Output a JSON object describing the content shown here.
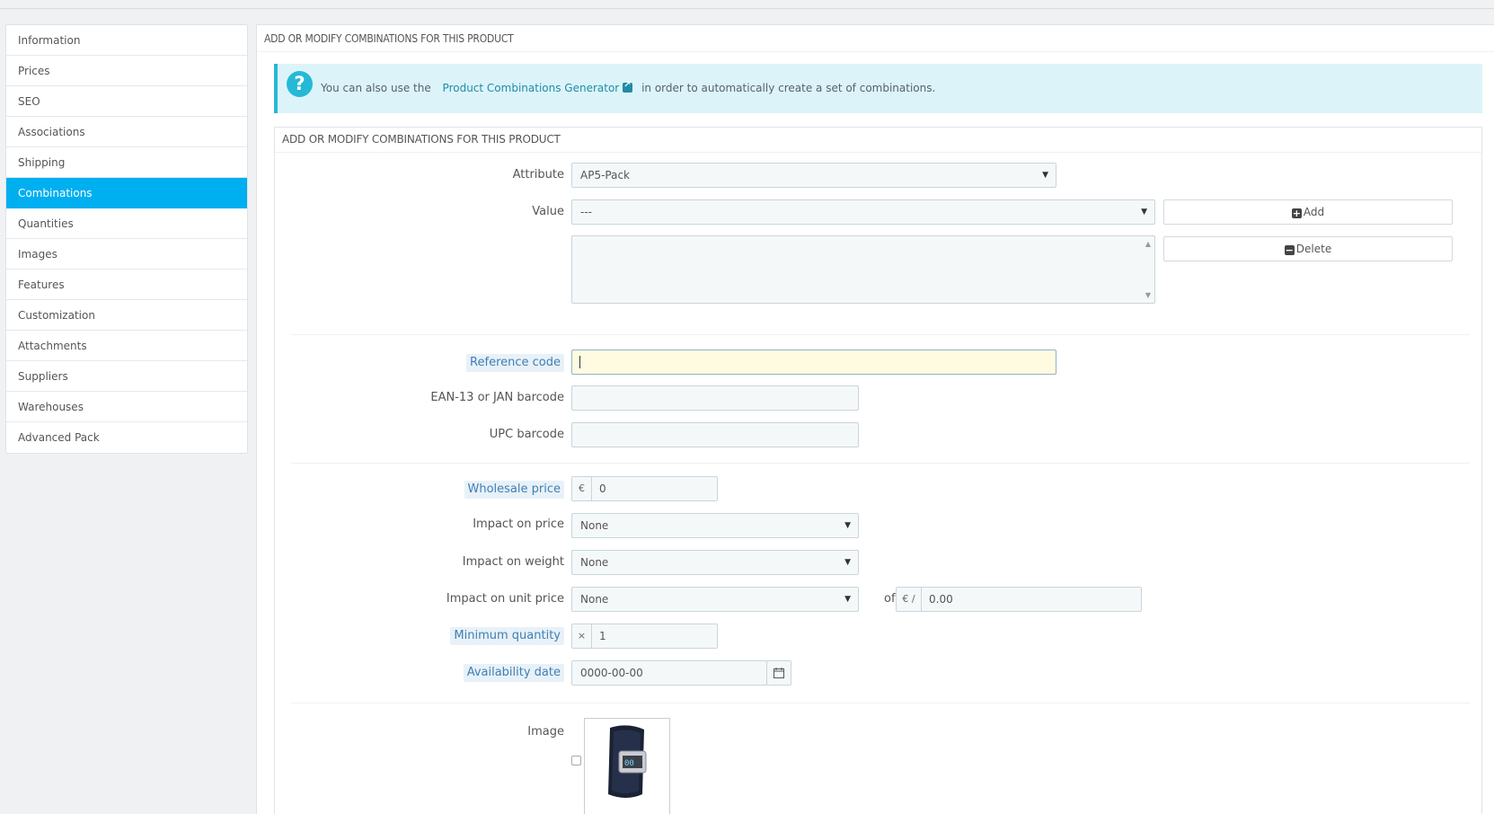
{
  "sidebar": {
    "items": [
      {
        "label": "Information"
      },
      {
        "label": "Prices"
      },
      {
        "label": "SEO"
      },
      {
        "label": "Associations"
      },
      {
        "label": "Shipping"
      },
      {
        "label": "Combinations",
        "active": true
      },
      {
        "label": "Quantities"
      },
      {
        "label": "Images"
      },
      {
        "label": "Features"
      },
      {
        "label": "Customization"
      },
      {
        "label": "Attachments"
      },
      {
        "label": "Suppliers"
      },
      {
        "label": "Warehouses"
      },
      {
        "label": "Advanced Pack"
      }
    ]
  },
  "panel": {
    "title": "ADD OR MODIFY COMBINATIONS FOR THIS PRODUCT"
  },
  "alert": {
    "prefix": "You can also use the",
    "link": "Product Combinations Generator",
    "suffix": "in order to automatically create a set of combinations."
  },
  "form": {
    "title": "ADD OR MODIFY COMBINATIONS FOR THIS PRODUCT",
    "attribute_label": "Attribute",
    "attribute_value": "AP5-Pack",
    "value_label": "Value",
    "value_value": "---",
    "add_label": "Add",
    "delete_label": "Delete",
    "reference_label": "Reference code",
    "reference_value": "",
    "ean_label": "EAN-13 or JAN barcode",
    "upc_label": "UPC barcode",
    "wholesale_label": "Wholesale price",
    "wholesale_currency": "€",
    "wholesale_value": "0",
    "impact_price_label": "Impact on price",
    "impact_price_value": "None",
    "impact_weight_label": "Impact on weight",
    "impact_weight_value": "None",
    "impact_unit_label": "Impact on unit price",
    "impact_unit_value": "None",
    "of_label": "of",
    "unit_currency": "€ /",
    "unit_value": "0.00",
    "min_qty_label": "Minimum quantity",
    "min_qty_prefix": "×",
    "min_qty_value": "1",
    "avail_label": "Availability date",
    "avail_value": "0000-00-00",
    "image_label": "Image"
  },
  "colors": {
    "accent": "#00aff0",
    "alert_bg": "#dcf4f9",
    "alert_icon": "#25b9d7",
    "focus_field": "#fffbe1"
  }
}
